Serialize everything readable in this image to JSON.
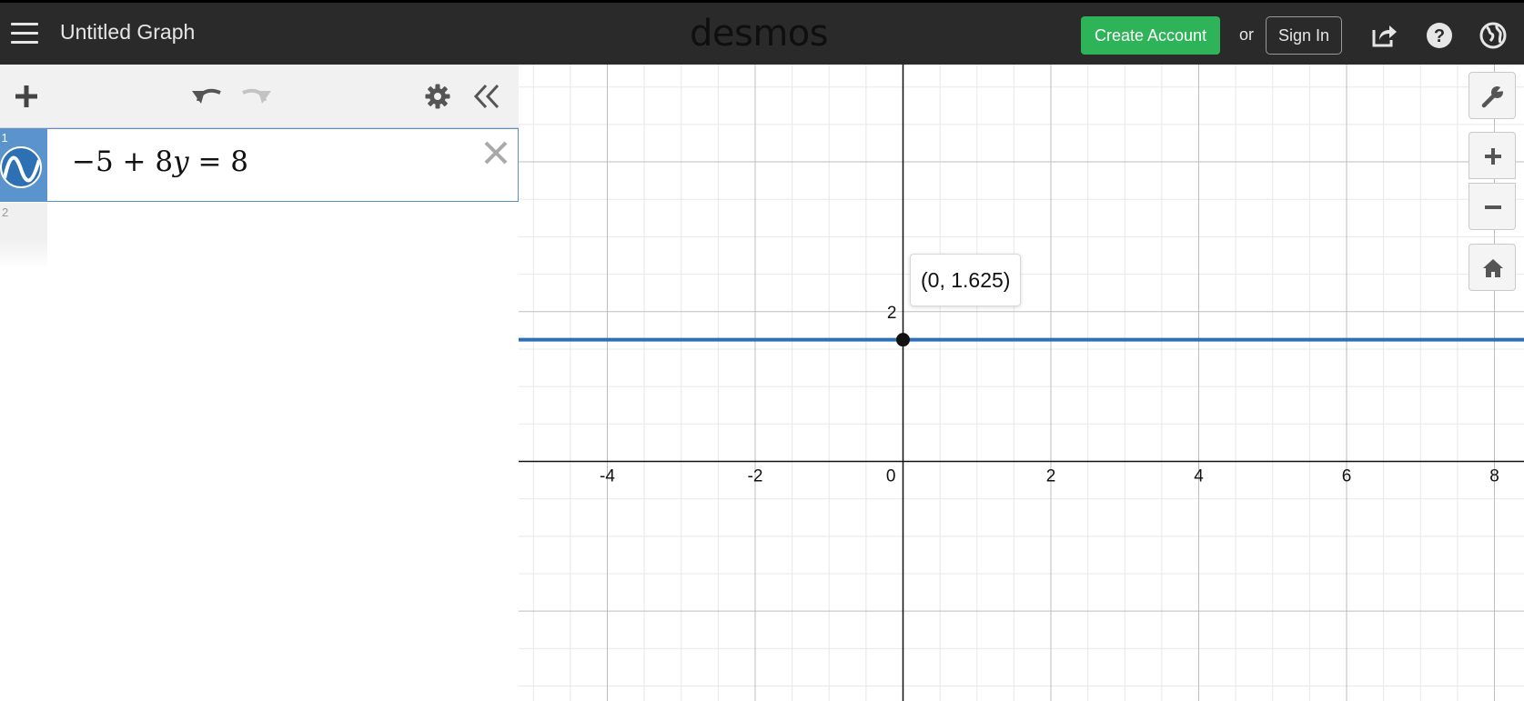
{
  "header": {
    "graph_title": "Untitled Graph",
    "brand": "desmos",
    "create_account_label": "Create Account",
    "or_text": "or",
    "sign_in_label": "Sign In"
  },
  "expressions": [
    {
      "index": "1",
      "latex_parts": [
        "−5 + 8",
        "y",
        " = 8"
      ],
      "color": "#2d70b3"
    },
    {
      "index": "2"
    }
  ],
  "graph": {
    "x_ticks": [
      "-4",
      "-2",
      "0",
      "2",
      "4",
      "6",
      "8"
    ],
    "y_ticks": [
      "2"
    ],
    "x_range": [
      -5.2,
      8.4
    ],
    "y_range": [
      -3.2,
      5.3
    ],
    "line_y": 1.625,
    "point": {
      "x": 0,
      "y": 1.625,
      "label": "(0, 1.625)"
    },
    "line_color": "#2d70b3"
  },
  "colors": {
    "header_bg": "#2a2a2a",
    "create_account_bg": "#2eb358",
    "selected_tab": "#5b93cd"
  }
}
